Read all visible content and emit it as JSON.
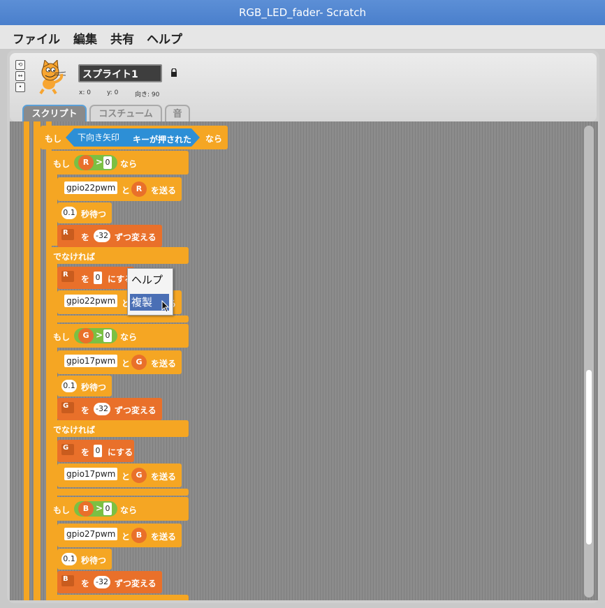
{
  "window": {
    "title": "RGB_LED_fader- Scratch"
  },
  "menu": {
    "file": "ファイル",
    "edit": "編集",
    "share": "共有",
    "help": "ヘルプ"
  },
  "sprite": {
    "name": "スプライト1",
    "x_label": "x: 0",
    "y_label": "y: 0",
    "dir_label": "向き: 90"
  },
  "tabs": {
    "scripts": "スクリプト",
    "costumes": "コスチューム",
    "sounds": "音"
  },
  "context_menu": {
    "help": "ヘルプ",
    "duplicate": "複製"
  },
  "blocks": {
    "if_label": "もし",
    "then_label": "なら",
    "else_label": "でなければ",
    "key_sensor": {
      "key": "下向き矢印",
      "text": "キーが押された"
    },
    "send_suffix": "を送る",
    "and_label": "と",
    "wait_suffix": "秒待つ",
    "wo_label": "を",
    "change_suffix": "ずつ変える",
    "set_suffix": "にする",
    "gt": ">",
    "sections": [
      {
        "var": "R",
        "cmp_val": "0",
        "pin": "gpio22pwm",
        "wait": "0.1",
        "delta": "-32",
        "set_val": "0"
      },
      {
        "var": "G",
        "cmp_val": "0",
        "pin": "gpio17pwm",
        "wait": "0.1",
        "delta": "-32",
        "set_val": "0"
      },
      {
        "var": "B",
        "cmp_val": "0",
        "pin": "gpio27pwm",
        "wait": "0.1",
        "delta": "-32"
      }
    ]
  }
}
